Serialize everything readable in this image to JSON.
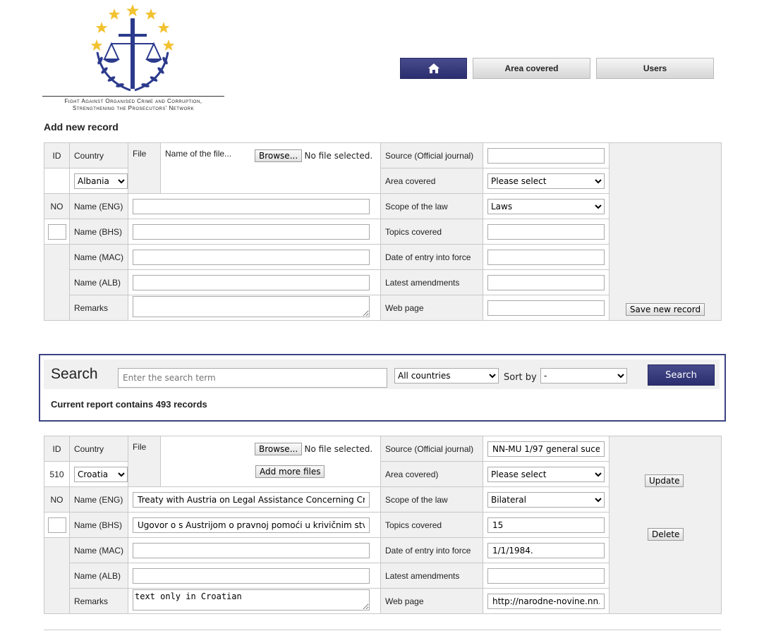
{
  "header": {
    "logo_tagline_line1": "Fight Against Organised Crime and Corruption,",
    "logo_tagline_line2": "Strengthening the Prosecutors' Network"
  },
  "nav": {
    "home_icon": "home-icon",
    "area_covered": "Area covered",
    "users": "Users"
  },
  "add_form": {
    "title": "Add new record",
    "labels": {
      "id": "ID",
      "country": "Country",
      "file": "File",
      "file_name": "Name of the file...",
      "no": "NO",
      "name_eng": "Name (ENG)",
      "name_bhs": "Name (BHS)",
      "name_mac": "Name (MAC)",
      "name_alb": "Name (ALB)",
      "remarks": "Remarks",
      "source": "Source (Official journal)",
      "area_covered": "Area covered",
      "scope": "Scope of the law",
      "topics": "Topics covered",
      "date_entry": "Date of entry into force",
      "latest_amend": "Latest amendments",
      "web_page": "Web page"
    },
    "browse": "Browse...",
    "no_file": "No file selected.",
    "country_value": "Albania",
    "area_value": "Please select",
    "scope_value": "Laws",
    "save_button": "Save new record"
  },
  "search": {
    "label": "Search",
    "placeholder": "Enter the search term",
    "country_filter": "All countries",
    "sort_by_label": "Sort by",
    "sort_value": "-",
    "button": "Search",
    "report": "Current report contains 493 records"
  },
  "record": {
    "labels": {
      "id": "ID",
      "country": "Country",
      "file": "File",
      "no": "NO",
      "name_eng": "Name (ENG)",
      "name_bhs": "Name (BHS)",
      "name_mac": "Name (MAC)",
      "name_alb": "Name (ALB)",
      "remarks": "Remarks",
      "source": "Source (Official journal)",
      "area_covered": "Area covered)",
      "scope": "Scope of the law",
      "topics": "Topics covered",
      "date_entry": "Date of entry into force",
      "latest_amend": "Latest amendments",
      "web_page": "Web page"
    },
    "id_value": "510",
    "country_value": "Croatia",
    "browse": "Browse...",
    "no_file": "No file selected.",
    "add_more_files": "Add more files",
    "name_eng_value": "Treaty with Austria on Legal Assistance Concerning Crir",
    "name_bhs_value": "Ugovor o s Austrijom o pravnoj pomoći u krivičnim stvar",
    "name_mac_value": "",
    "name_alb_value": "",
    "remarks_value": "text only in Croatian",
    "source_value": "NN-MU 1/97 general suces",
    "area_value": "Please select",
    "scope_value": "Bilateral",
    "topics_value": "15",
    "date_entry_value": "1/1/1984.",
    "latest_amend_value": "",
    "web_page_value": "http://narodne-novine.nn.hr",
    "update_button": "Update",
    "delete_button": "Delete"
  }
}
